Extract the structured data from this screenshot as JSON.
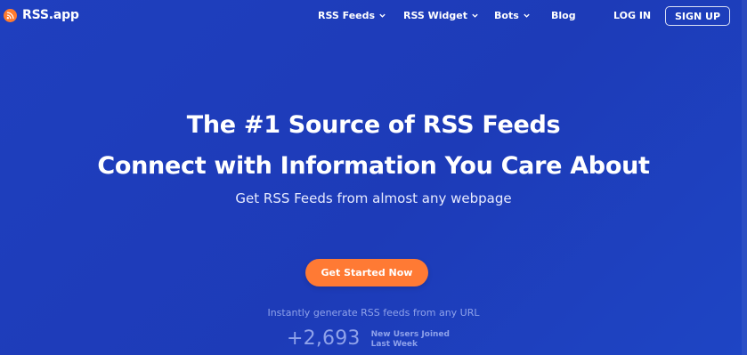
{
  "brand": {
    "name": "RSS.app",
    "icon": "rss-icon",
    "icon_color": "#ff7b2e"
  },
  "nav": {
    "items": [
      {
        "label": "RSS Feeds",
        "has_dropdown": true
      },
      {
        "label": "RSS Widget",
        "has_dropdown": true
      },
      {
        "label": "Bots",
        "has_dropdown": true
      },
      {
        "label": "Blog",
        "has_dropdown": false
      }
    ],
    "login": "LOG IN",
    "signup": "SIGN UP"
  },
  "hero": {
    "title_line1": "The #1 Source of RSS Feeds",
    "title_line2": "Connect with Information You Care About",
    "subtitle": "Get RSS Feeds from almost any webpage",
    "cta_label": "Get Started Now",
    "tagline": "Instantly generate RSS feeds from any URL"
  },
  "stats": {
    "count": "+2,693",
    "label_line1": "New Users Joined",
    "label_line2": "Last Week"
  },
  "colors": {
    "background": "#1f3fbe",
    "accent": "#ff7a34",
    "muted_text": "#8fa2ea"
  }
}
